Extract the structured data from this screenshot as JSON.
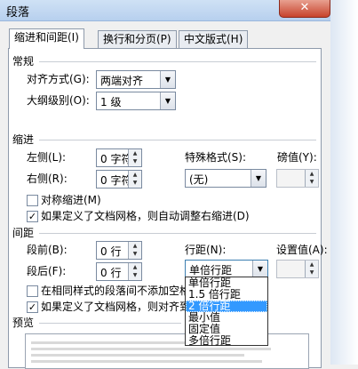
{
  "window": {
    "title": "段落",
    "close_glyph": "✕"
  },
  "tabs": [
    {
      "label": "缩进和间距(I)",
      "active": true
    },
    {
      "label": "换行和分页(P)",
      "active": false
    },
    {
      "label": "中文版式(H)",
      "active": false
    }
  ],
  "general": {
    "section": "常规",
    "alignment_label": "对齐方式(G):",
    "alignment_value": "两端对齐",
    "outline_label": "大纲级别(O):",
    "outline_value": "1 级"
  },
  "indent": {
    "section": "缩进",
    "left_label": "左侧(L):",
    "left_value": "0 字符",
    "right_label": "右侧(R):",
    "right_value": "0 字符",
    "special_label": "特殊格式(S):",
    "special_value": "(无)",
    "by_label": "磅值(Y):",
    "by_value": "",
    "mirror_label": "对称缩进(M)",
    "mirror_checked": false,
    "grid_label": "如果定义了文档网格，则自动调整右缩进(D)",
    "grid_checked": true
  },
  "spacing": {
    "section": "间距",
    "before_label": "段前(B):",
    "before_value": "0 行",
    "after_label": "段后(F):",
    "after_value": "0 行",
    "line_label": "行距(N):",
    "line_value": "单倍行距",
    "at_label": "设置值(A):",
    "at_value": "",
    "no_space_label": "在相同样式的段落间不添加空格",
    "no_space_checked": false,
    "snap_label": "如果定义了文档网格，则对齐到",
    "snap_checked": true
  },
  "line_spacing_options": [
    {
      "label": "单倍行距",
      "selected": false
    },
    {
      "label": "1.5 倍行距",
      "selected": false
    },
    {
      "label": "2 倍行距",
      "selected": true
    },
    {
      "label": "最小值",
      "selected": false
    },
    {
      "label": "固定值",
      "selected": false
    },
    {
      "label": "多倍行距",
      "selected": false
    }
  ],
  "preview": {
    "section": "预览"
  },
  "icons": {
    "dropdown": "chevron-down",
    "spin_up": "triangle-up",
    "spin_down": "triangle-down",
    "check": "checkmark"
  }
}
